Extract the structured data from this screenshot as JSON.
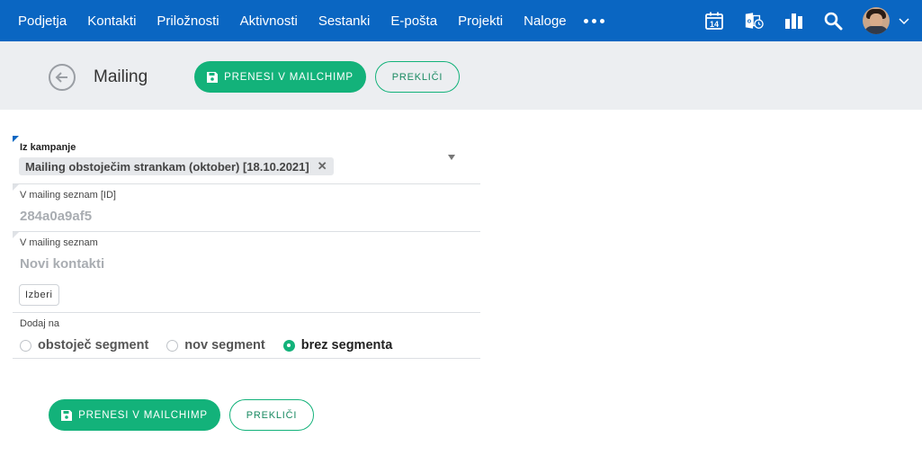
{
  "nav": {
    "items": [
      "Podjetja",
      "Kontakti",
      "Priložnosti",
      "Aktivnosti",
      "Sestanki",
      "E-pošta",
      "Projekti",
      "Naloge"
    ],
    "calendar_day": "14",
    "icons": [
      "calendar-icon",
      "outlook-sync-icon",
      "reports-icon",
      "search-icon",
      "avatar",
      "chevron-down-icon"
    ]
  },
  "header": {
    "title": "Mailing",
    "primary_label": "PRENESI V MAILCHIMP",
    "cancel_label": "PREKLIČI"
  },
  "form": {
    "campaign_label": "Iz kampanje",
    "campaign_value": "Mailing obstoječim strankam (oktober) [18.10.2021]",
    "list_id_label": "V mailing seznam [ID]",
    "list_id_value": "284a0a9af5",
    "list_label": "V mailing seznam",
    "list_value": "Novi kontakti",
    "choose_label": "Izberi",
    "add_to_label": "Dodaj na",
    "radio_options": [
      "obstoječ segment",
      "nov segment",
      "brez segmenta"
    ],
    "radio_selected": "brez segmenta"
  },
  "footer": {
    "primary_label": "PRENESI V MAILCHIMP",
    "cancel_label": "PREKLIČI"
  },
  "colors": {
    "nav_bg": "#0a66c2",
    "accent_green": "#13b27a",
    "header_bg": "#eceef1"
  }
}
